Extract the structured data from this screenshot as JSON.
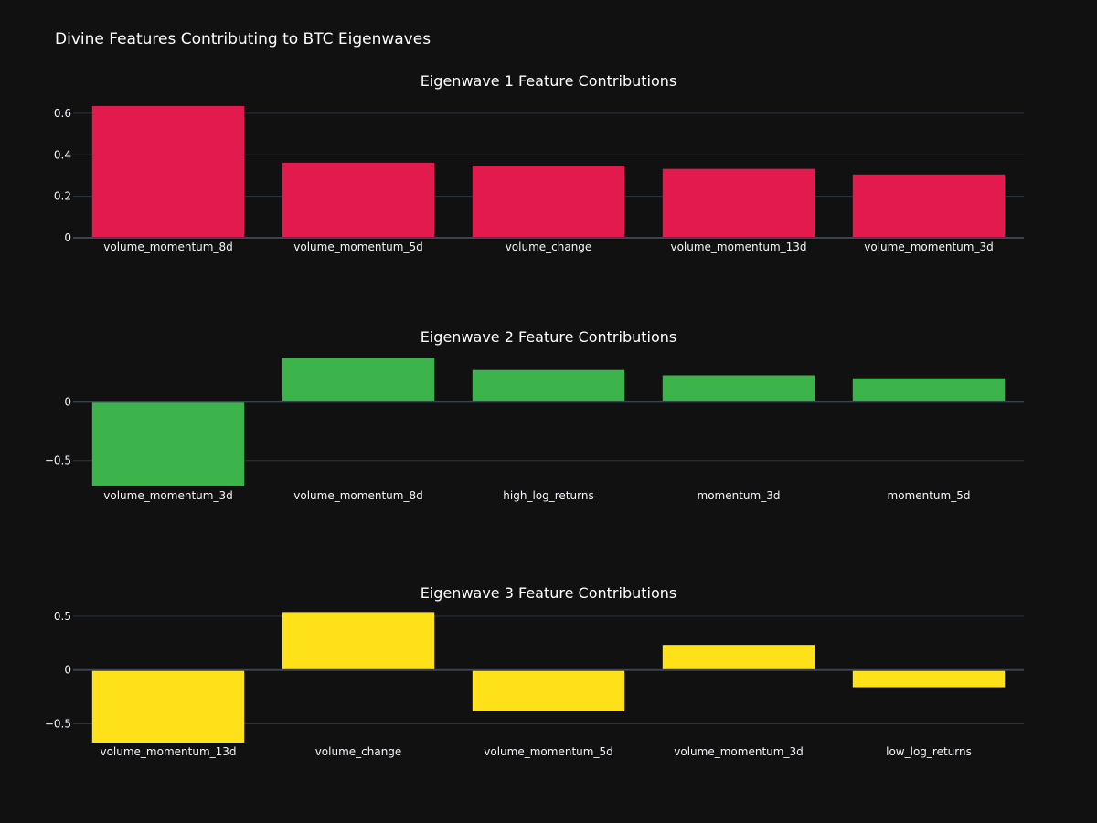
{
  "figure": {
    "title": "Divine Features Contributing to BTC Eigenwaves"
  },
  "colors": {
    "background": "#111111",
    "grid": "#283442",
    "zeroline": "#3a4450",
    "text": "#f2f5fa"
  },
  "chart_data": [
    {
      "type": "bar",
      "title": "Eigenwave 1 Feature Contributions",
      "color": "#e31a4d",
      "categories": [
        "volume_momentum_8d",
        "volume_momentum_5d",
        "volume_change",
        "volume_momentum_13d",
        "volume_momentum_3d"
      ],
      "values": [
        0.635,
        0.362,
        0.348,
        0.332,
        0.305
      ],
      "ylim": [
        0,
        0.67
      ],
      "yticks": [
        0,
        0.2,
        0.4,
        0.6
      ],
      "ytick_labels": [
        "0",
        "0.2",
        "0.4",
        "0.6"
      ],
      "grid": true
    },
    {
      "type": "bar",
      "title": "Eigenwave 2 Feature Contributions",
      "color": "#3cb44b",
      "categories": [
        "volume_momentum_3d",
        "volume_momentum_8d",
        "high_log_returns",
        "momentum_3d",
        "momentum_5d"
      ],
      "values": [
        -0.72,
        0.375,
        0.27,
        0.225,
        0.2
      ],
      "ylim": [
        -0.72,
        0.4
      ],
      "yticks": [
        -0.5,
        0
      ],
      "ytick_labels": [
        "−0.5",
        "0"
      ],
      "grid": true
    },
    {
      "type": "bar",
      "title": "Eigenwave 3 Feature Contributions",
      "color": "#ffe119",
      "categories": [
        "volume_momentum_13d",
        "volume_change",
        "volume_momentum_5d",
        "volume_momentum_3d",
        "low_log_returns"
      ],
      "values": [
        -0.675,
        0.54,
        -0.385,
        0.235,
        -0.16
      ],
      "ylim": [
        -0.675,
        0.56
      ],
      "yticks": [
        -0.5,
        0,
        0.5
      ],
      "ytick_labels": [
        "−0.5",
        "0",
        "0.5"
      ],
      "grid": true
    }
  ]
}
